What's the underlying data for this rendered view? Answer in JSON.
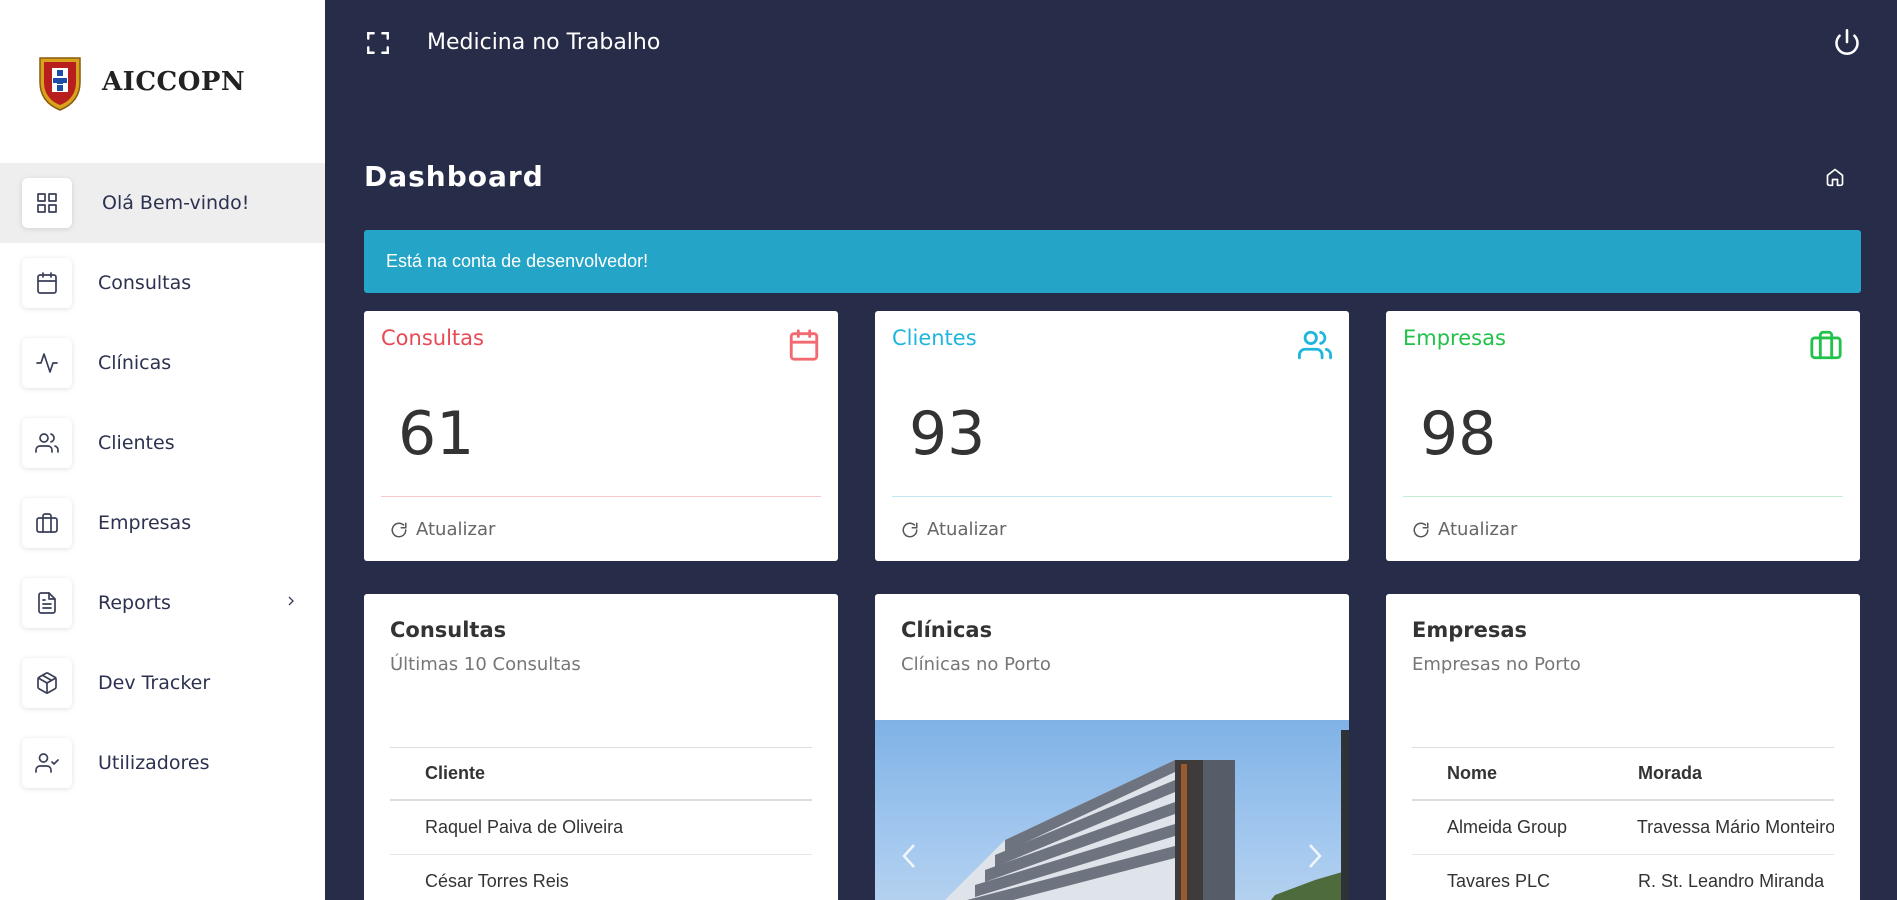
{
  "brand": {
    "name": "AICCOPN"
  },
  "sidebar": {
    "items": [
      {
        "label": "Olá Bem-vindo!",
        "icon": "grid-icon",
        "active": true
      },
      {
        "label": "Consultas",
        "icon": "calendar-icon"
      },
      {
        "label": "Clínicas",
        "icon": "activity-icon"
      },
      {
        "label": "Clientes",
        "icon": "users-icon"
      },
      {
        "label": "Empresas",
        "icon": "briefcase-icon"
      },
      {
        "label": "Reports",
        "icon": "file-text-icon",
        "has_submenu": true
      },
      {
        "label": "Dev Tracker",
        "icon": "package-icon"
      },
      {
        "label": "Utilizadores",
        "icon": "user-check-icon"
      }
    ]
  },
  "topbar": {
    "title": "Medicina no Trabalho"
  },
  "page": {
    "title": "Dashboard"
  },
  "alert": {
    "text": "Está na conta de desenvolvedor!"
  },
  "stats": [
    {
      "title": "Consultas",
      "value": "61",
      "refresh": "Atualizar",
      "color": "#e84a55",
      "icon": "calendar-icon"
    },
    {
      "title": "Clientes",
      "value": "93",
      "refresh": "Atualizar",
      "color": "#1eb6dd",
      "icon": "users-icon"
    },
    {
      "title": "Empresas",
      "value": "98",
      "refresh": "Atualizar",
      "color": "#20c24a",
      "icon": "briefcase-icon"
    }
  ],
  "panels": {
    "consultas": {
      "title": "Consultas",
      "subtitle": "Últimas 10 Consultas",
      "columns": [
        "Cliente"
      ],
      "rows": [
        [
          "Raquel Paiva de Oliveira"
        ],
        [
          "César Torres Reis"
        ]
      ]
    },
    "clinicas": {
      "title": "Clínicas",
      "subtitle": "Clínicas no Porto"
    },
    "empresas": {
      "title": "Empresas",
      "subtitle": "Empresas no Porto",
      "columns": [
        "Nome",
        "Morada"
      ],
      "rows": [
        [
          "Almeida Group",
          "Travessa Mário Monteiro"
        ],
        [
          "Tavares PLC",
          "R. St. Leandro Miranda"
        ]
      ]
    }
  },
  "colors": {
    "background": "#272d49",
    "alert": "#24a4c6",
    "sidebar_active": "#eeeeee"
  }
}
